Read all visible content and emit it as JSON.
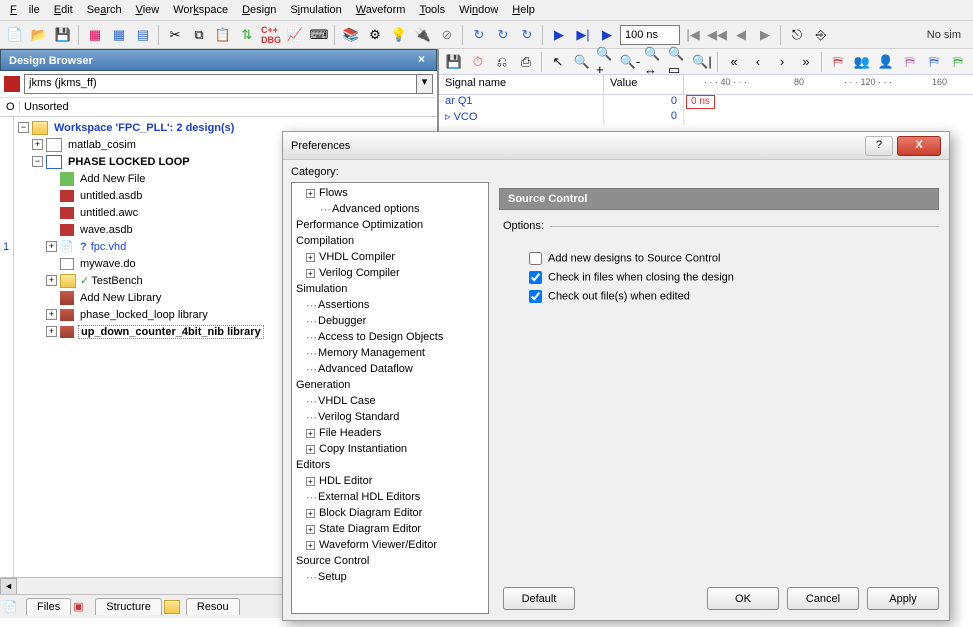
{
  "menu": [
    "File",
    "Edit",
    "Search",
    "View",
    "Workspace",
    "Design",
    "Simulation",
    "Waveform",
    "Tools",
    "Window",
    "Help"
  ],
  "toolbar1": {
    "time_value": "100 ns",
    "status_right": "No sim"
  },
  "design_browser": {
    "title": "Design Browser",
    "combo_value": "jkms (jkms_ff)",
    "sort_label": "Unsorted",
    "gutter_mark": "1",
    "tree": {
      "workspace": "Workspace 'FPC_PLL': 2 design(s)",
      "matlab": "matlab_cosim",
      "pll": "PHASE LOCKED LOOP",
      "items": [
        "Add New File",
        "untitled.asdb",
        "untitled.awc",
        "wave.asdb",
        "fpc.vhd",
        "mywave.do",
        "TestBench",
        "Add New Library",
        "phase_locked_loop library",
        "up_down_counter_4bit_nib library"
      ]
    },
    "tabs": [
      "Files",
      "Structure",
      "Resou"
    ]
  },
  "wave": {
    "headers": {
      "signal": "Signal name",
      "value": "Value"
    },
    "ruler": [
      "· · · 40 · · ·",
      "80",
      "· · · 120 · · ·",
      "160"
    ],
    "cursor": "0 ns",
    "rows": [
      {
        "name": "ar Q1",
        "value": "0"
      },
      {
        "name": "▹ VCO",
        "value": "0"
      }
    ]
  },
  "preferences": {
    "title": "Preferences",
    "category_label": "Category:",
    "categories": [
      {
        "t": "Flows",
        "l": 1,
        "pm": "+"
      },
      {
        "t": "Advanced options",
        "l": 2,
        "dots": true
      },
      {
        "t": "Performance Optimization",
        "l": 0
      },
      {
        "t": "Compilation",
        "l": 0
      },
      {
        "t": "VHDL Compiler",
        "l": 1,
        "pm": "+"
      },
      {
        "t": "Verilog Compiler",
        "l": 1,
        "pm": "+"
      },
      {
        "t": "Simulation",
        "l": 0
      },
      {
        "t": "Assertions",
        "l": 1,
        "dots": true
      },
      {
        "t": "Debugger",
        "l": 1,
        "dots": true
      },
      {
        "t": "Access to Design Objects",
        "l": 1,
        "dots": true
      },
      {
        "t": "Memory Management",
        "l": 1,
        "dots": true
      },
      {
        "t": "Advanced Dataflow",
        "l": 1,
        "dots": true
      },
      {
        "t": "Generation",
        "l": 0
      },
      {
        "t": "VHDL Case",
        "l": 1,
        "dots": true
      },
      {
        "t": "Verilog Standard",
        "l": 1,
        "dots": true
      },
      {
        "t": "File Headers",
        "l": 1,
        "pm": "+"
      },
      {
        "t": "Copy Instantiation",
        "l": 1,
        "pm": "+"
      },
      {
        "t": "Editors",
        "l": 0
      },
      {
        "t": "HDL Editor",
        "l": 1,
        "pm": "+"
      },
      {
        "t": "External HDL Editors",
        "l": 1,
        "dots": true
      },
      {
        "t": "Block Diagram Editor",
        "l": 1,
        "pm": "+"
      },
      {
        "t": "State Diagram Editor",
        "l": 1,
        "pm": "+"
      },
      {
        "t": "Waveform Viewer/Editor",
        "l": 1,
        "pm": "+"
      },
      {
        "t": "Source Control",
        "l": 0
      },
      {
        "t": "Setup",
        "l": 1,
        "dots": true
      }
    ],
    "section_header": "Source Control",
    "options_label": "Options:",
    "options": [
      {
        "label": "Add new designs to Source Control",
        "checked": false
      },
      {
        "label": "Check in files when closing the design",
        "checked": true
      },
      {
        "label": "Check out file(s) when edited",
        "checked": true
      }
    ],
    "buttons": {
      "default": "Default",
      "ok": "OK",
      "cancel": "Cancel",
      "apply": "Apply"
    }
  }
}
